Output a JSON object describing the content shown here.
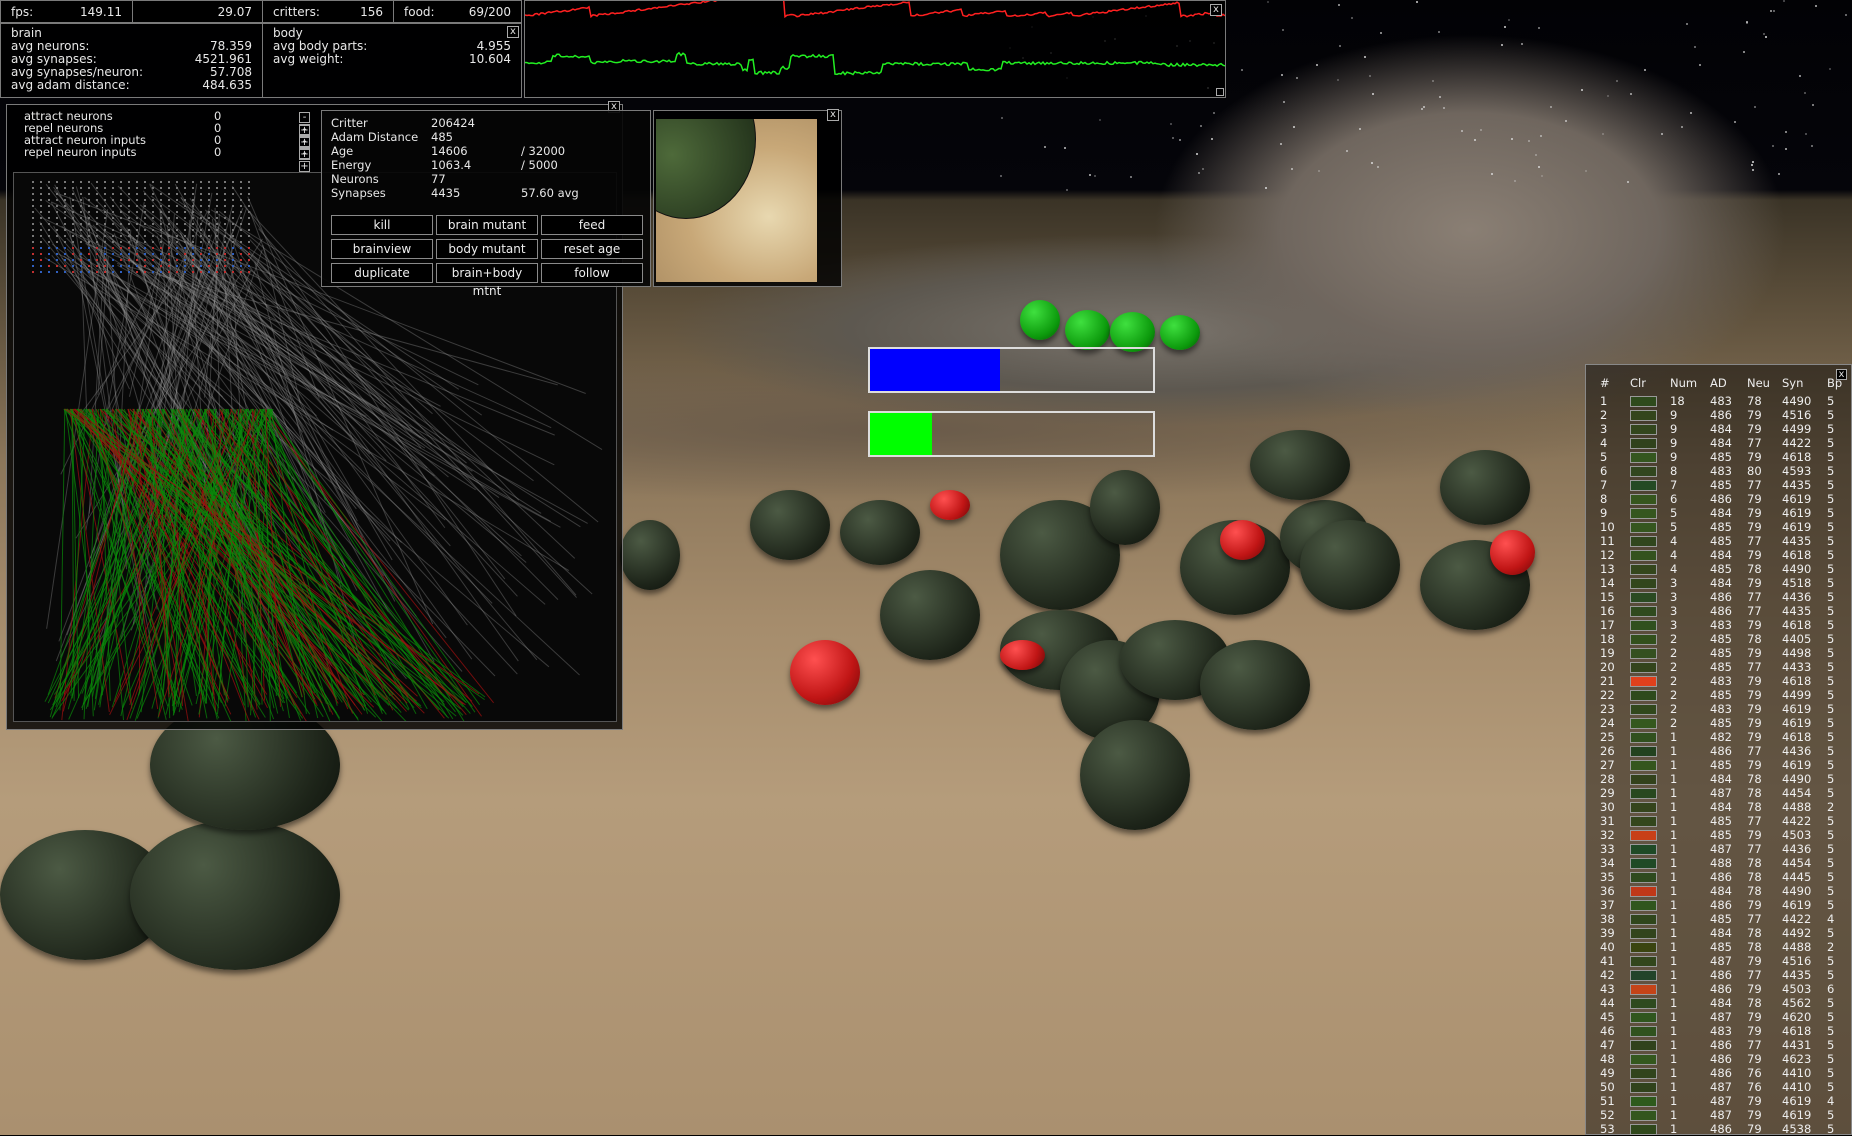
{
  "stats": {
    "fps_label": "fps:",
    "fps": "149.11",
    "fps2": "29.07",
    "critters_label": "critters:",
    "critters": "156",
    "food_label": "food:",
    "food": "69/200"
  },
  "brain": {
    "title": "brain",
    "rows": [
      {
        "label": "avg neurons:",
        "value": "78.359"
      },
      {
        "label": "avg synapses:",
        "value": "4521.961"
      },
      {
        "label": "avg synapses/neuron:",
        "value": "57.708"
      },
      {
        "label": "avg adam distance:",
        "value": "484.635"
      }
    ]
  },
  "body": {
    "title": "body",
    "rows": [
      {
        "label": "avg body parts:",
        "value": "4.955"
      },
      {
        "label": "avg weight:",
        "value": "10.604"
      }
    ]
  },
  "close_label": "x",
  "graph": {
    "colors": {
      "line1": "#ff2020",
      "line2": "#22ee22"
    }
  },
  "brain_controls": [
    {
      "label": "attract neurons",
      "value": "0"
    },
    {
      "label": "repel neurons",
      "value": "0"
    },
    {
      "label": "attract neuron inputs",
      "value": "0"
    },
    {
      "label": "repel neuron inputs",
      "value": "0"
    }
  ],
  "minus": "-",
  "plus": "+",
  "critter": {
    "rows": [
      {
        "label": "Critter",
        "value": "206424",
        "extra": ""
      },
      {
        "label": "Adam Distance",
        "value": "485",
        "extra": ""
      },
      {
        "label": "Age",
        "value": "14606",
        "extra": "/  32000"
      },
      {
        "label": "Energy",
        "value": "1063.4",
        "extra": "/  5000"
      },
      {
        "label": "Neurons",
        "value": "77",
        "extra": ""
      },
      {
        "label": "Synapses",
        "value": "4435",
        "extra": "57.60 avg"
      }
    ],
    "buttons": [
      "kill",
      "brain mutant",
      "feed",
      "brainview",
      "body mutant",
      "reset age",
      "duplicate",
      "brain+body mtnt",
      "follow"
    ]
  },
  "bars": [
    {
      "color": "#0000ff",
      "fraction": 0.46
    },
    {
      "color": "#00ff00",
      "fraction": 0.22
    }
  ],
  "species": {
    "headers": [
      "#",
      "Clr",
      "Num",
      "AD",
      "Neu",
      "Syn",
      "Bp"
    ],
    "rows": [
      [
        "1",
        "#2e4a1c",
        "18",
        "483",
        "78",
        "4490",
        "5"
      ],
      [
        "2",
        "#33451c",
        "9",
        "486",
        "79",
        "4516",
        "5"
      ],
      [
        "3",
        "#33461d",
        "9",
        "484",
        "79",
        "4499",
        "5"
      ],
      [
        "4",
        "#30421c",
        "9",
        "484",
        "77",
        "4422",
        "5"
      ],
      [
        "5",
        "#34561f",
        "9",
        "485",
        "79",
        "4618",
        "5"
      ],
      [
        "6",
        "#31461e",
        "8",
        "483",
        "80",
        "4593",
        "5"
      ],
      [
        "7",
        "#244a24",
        "7",
        "485",
        "77",
        "4435",
        "5"
      ],
      [
        "8",
        "#36561e",
        "6",
        "486",
        "79",
        "4619",
        "5"
      ],
      [
        "9",
        "#35561f",
        "5",
        "484",
        "79",
        "4619",
        "5"
      ],
      [
        "10",
        "#35561f",
        "5",
        "485",
        "79",
        "4619",
        "5"
      ],
      [
        "11",
        "#30461d",
        "4",
        "485",
        "77",
        "4435",
        "5"
      ],
      [
        "12",
        "#33521e",
        "4",
        "484",
        "79",
        "4618",
        "5"
      ],
      [
        "13",
        "#34461c",
        "4",
        "485",
        "78",
        "4490",
        "5"
      ],
      [
        "14",
        "#32461c",
        "3",
        "484",
        "79",
        "4518",
        "5"
      ],
      [
        "15",
        "#2a4a22",
        "3",
        "486",
        "77",
        "4436",
        "5"
      ],
      [
        "16",
        "#2f4a1e",
        "3",
        "486",
        "77",
        "4435",
        "5"
      ],
      [
        "17",
        "#30501e",
        "3",
        "483",
        "79",
        "4618",
        "5"
      ],
      [
        "18",
        "#32501c",
        "2",
        "485",
        "78",
        "4405",
        "5"
      ],
      [
        "19",
        "#345020",
        "2",
        "485",
        "79",
        "4498",
        "5"
      ],
      [
        "20",
        "#33441c",
        "2",
        "485",
        "77",
        "4433",
        "5"
      ],
      [
        "21",
        "#e0401c",
        "2",
        "483",
        "79",
        "4618",
        "5"
      ],
      [
        "22",
        "#2e4a1c",
        "2",
        "485",
        "79",
        "4499",
        "5"
      ],
      [
        "23",
        "#31481c",
        "2",
        "483",
        "79",
        "4619",
        "5"
      ],
      [
        "24",
        "#34581e",
        "2",
        "485",
        "79",
        "4619",
        "5"
      ],
      [
        "25",
        "#30501e",
        "1",
        "482",
        "79",
        "4618",
        "5"
      ],
      [
        "26",
        "#22421f",
        "1",
        "486",
        "77",
        "4436",
        "5"
      ],
      [
        "27",
        "#34561e",
        "1",
        "485",
        "79",
        "4619",
        "5"
      ],
      [
        "28",
        "#33421c",
        "1",
        "484",
        "78",
        "4490",
        "5"
      ],
      [
        "29",
        "#28481f",
        "1",
        "487",
        "78",
        "4454",
        "5"
      ],
      [
        "30",
        "#34441c",
        "1",
        "484",
        "78",
        "4488",
        "2"
      ],
      [
        "31",
        "#33461c",
        "1",
        "485",
        "77",
        "4422",
        "5"
      ],
      [
        "32",
        "#c84018",
        "1",
        "485",
        "79",
        "4503",
        "5"
      ],
      [
        "33",
        "#1f4a26",
        "1",
        "487",
        "77",
        "4436",
        "5"
      ],
      [
        "34",
        "#1f4a26",
        "1",
        "488",
        "78",
        "4454",
        "5"
      ],
      [
        "35",
        "#2e4a1e",
        "1",
        "486",
        "78",
        "4445",
        "5"
      ],
      [
        "36",
        "#c03818",
        "1",
        "484",
        "78",
        "4490",
        "5"
      ],
      [
        "37",
        "#30561e",
        "1",
        "486",
        "79",
        "4619",
        "5"
      ],
      [
        "38",
        "#30461c",
        "1",
        "485",
        "77",
        "4422",
        "4"
      ],
      [
        "39",
        "#32441c",
        "1",
        "484",
        "78",
        "4492",
        "5"
      ],
      [
        "40",
        "#3a4410",
        "1",
        "485",
        "78",
        "4488",
        "2"
      ],
      [
        "41",
        "#32461c",
        "1",
        "487",
        "79",
        "4516",
        "5"
      ],
      [
        "42",
        "#22442a",
        "1",
        "486",
        "77",
        "4435",
        "5"
      ],
      [
        "43",
        "#c44418",
        "1",
        "486",
        "79",
        "4503",
        "6"
      ],
      [
        "44",
        "#2e4a1e",
        "1",
        "484",
        "78",
        "4562",
        "5"
      ],
      [
        "45",
        "#30561e",
        "1",
        "487",
        "79",
        "4620",
        "5"
      ],
      [
        "46",
        "#30521e",
        "1",
        "483",
        "79",
        "4618",
        "5"
      ],
      [
        "47",
        "#30421c",
        "1",
        "486",
        "77",
        "4431",
        "5"
      ],
      [
        "48",
        "#34581e",
        "1",
        "486",
        "79",
        "4623",
        "5"
      ],
      [
        "49",
        "#31441c",
        "1",
        "486",
        "76",
        "4410",
        "5"
      ],
      [
        "50",
        "#30421c",
        "1",
        "487",
        "76",
        "4410",
        "5"
      ],
      [
        "51",
        "#2e5a1c",
        "1",
        "487",
        "79",
        "4619",
        "4"
      ],
      [
        "52",
        "#33561e",
        "1",
        "487",
        "79",
        "4619",
        "5"
      ],
      [
        "53",
        "#30481c",
        "1",
        "486",
        "79",
        "4538",
        "5"
      ]
    ]
  }
}
